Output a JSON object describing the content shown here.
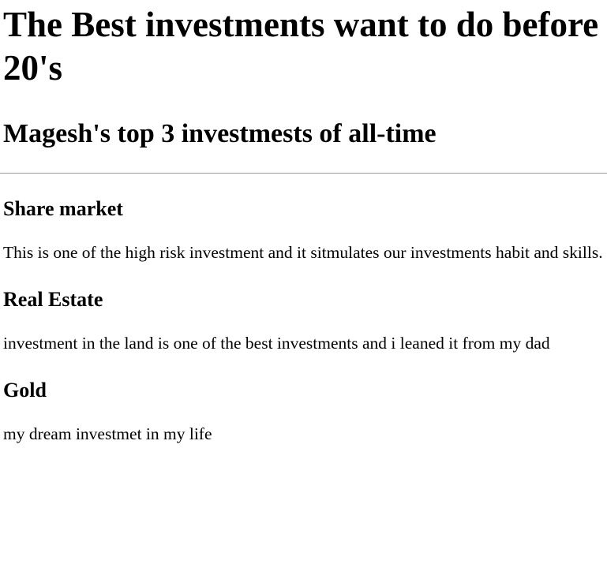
{
  "header": {
    "title": "The Best investments want to do before 20's",
    "subtitle": "Magesh's top 3 investmests of all-time"
  },
  "sections": [
    {
      "heading": "Share market",
      "text": "This is one of the high risk investment and it sitmulates our investments habit and skills."
    },
    {
      "heading": "Real Estate",
      "text": "investment in the land is one of the best investments and i leaned it from my dad"
    },
    {
      "heading": "Gold",
      "text": "my dream investmet in my life"
    }
  ]
}
